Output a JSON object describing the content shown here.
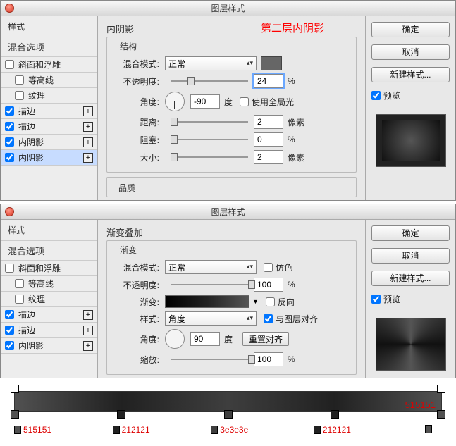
{
  "dialog_title": "图层样式",
  "annotation_text": "第二层内阴影",
  "sidebar": {
    "styles_header": "样式",
    "blend_header": "混合选项",
    "items": [
      {
        "label": "斜面和浮雕",
        "checked": false,
        "indent": 0,
        "plus": false
      },
      {
        "label": "等高线",
        "checked": false,
        "indent": 1,
        "plus": false
      },
      {
        "label": "纹理",
        "checked": false,
        "indent": 1,
        "plus": false
      },
      {
        "label": "描边",
        "checked": true,
        "indent": 0,
        "plus": true
      },
      {
        "label": "描边",
        "checked": true,
        "indent": 0,
        "plus": true
      },
      {
        "label": "内阴影",
        "checked": true,
        "indent": 0,
        "plus": true
      },
      {
        "label": "内阴影",
        "checked": true,
        "indent": 0,
        "plus": true,
        "selected": true
      }
    ]
  },
  "inner_shadow": {
    "group_title": "内阴影",
    "structure_label": "结构",
    "blend_mode_label": "混合模式:",
    "blend_mode_value": "正常",
    "opacity_label": "不透明度:",
    "opacity_value": "24",
    "opacity_unit": "%",
    "angle_label": "角度:",
    "angle_value": "-90",
    "angle_unit": "度",
    "global_light_label": "使用全局光",
    "distance_label": "距离:",
    "distance_value": "2",
    "distance_unit": "像素",
    "choke_label": "阻塞:",
    "choke_value": "0",
    "choke_unit": "%",
    "size_label": "大小:",
    "size_value": "2",
    "size_unit": "像素",
    "quality_label": "品质"
  },
  "gradient_overlay": {
    "group_title": "渐变叠加",
    "sub_label": "渐变",
    "blend_mode_label": "混合模式:",
    "blend_mode_value": "正常",
    "dither_label": "仿色",
    "opacity_label": "不透明度:",
    "opacity_value": "100",
    "opacity_unit": "%",
    "gradient_label": "渐变:",
    "reverse_label": "反向",
    "style_label": "样式:",
    "style_value": "角度",
    "align_label": "与图层对齐",
    "angle_label": "角度:",
    "angle_value": "90",
    "angle_unit": "度",
    "reset_align_label": "重置对齐",
    "scale_label": "缩放:",
    "scale_value": "100",
    "scale_unit": "%"
  },
  "right": {
    "ok": "确定",
    "cancel": "取消",
    "new_style": "新建样式...",
    "preview_label": "预览"
  },
  "gradient_editor": {
    "extra_label": "515151",
    "stops": [
      {
        "pos": 0,
        "color": "515151"
      },
      {
        "pos": 25,
        "color": "212121"
      },
      {
        "pos": 50,
        "color": "3e3e3e"
      },
      {
        "pos": 75,
        "color": "212121"
      },
      {
        "pos": 100,
        "color": "515151"
      }
    ]
  }
}
